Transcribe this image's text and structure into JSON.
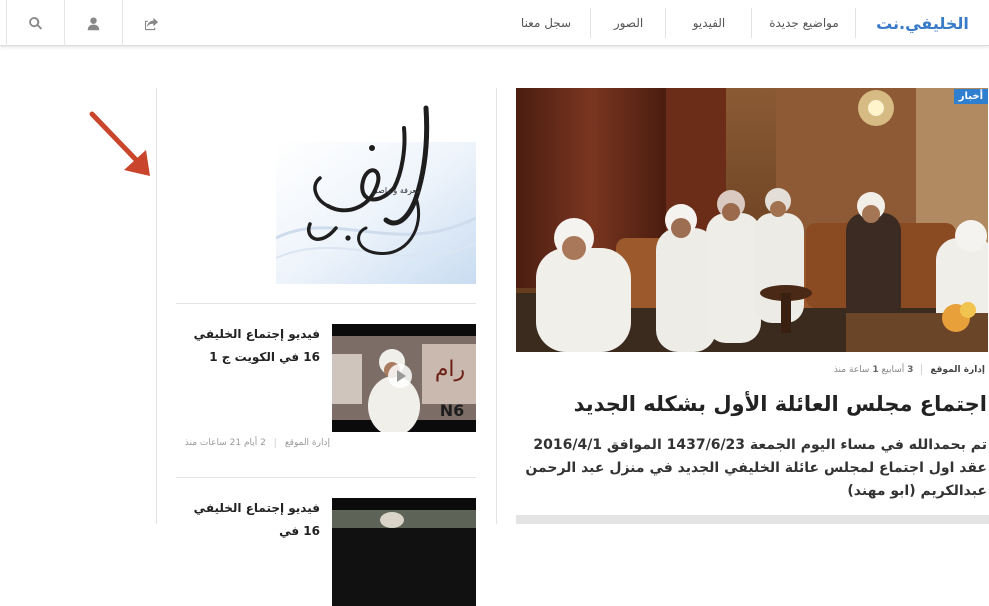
{
  "nav": {
    "brand": "الخليفي.نت",
    "items": [
      {
        "label": "مواضيع جديدة"
      },
      {
        "label": "الفيديو"
      },
      {
        "label": "الصور"
      },
      {
        "label": "سجل معنا"
      }
    ],
    "icons": [
      "share-icon",
      "user-icon",
      "search-icon"
    ]
  },
  "article": {
    "category": "أخبار",
    "author": "إدارة الموقع",
    "time_num": "3",
    "time_unit": "أسابيع",
    "time_count": "1",
    "time_suffix": "ساعة منذ",
    "title": "اجتماع مجلس العائلة الأول بشكله الجديد",
    "excerpt": "تم بحمدالله في مساء اليوم الجمعة 1437/6/23 الموافق 2016/4/1 عقد اول اجتماع لمجلس عائلة الخليفي الجديد في منزل عبد الرحمن عبدالكريم (ابو مهند)"
  },
  "sidebar": {
    "logo_caption": "معرفة وتواصل",
    "posts": [
      {
        "title": "فيديو إجتماع الخليفي 16 في الكويت ج 1",
        "author": "إدارة الموقع",
        "time": "2 أيام 21 ساعات منذ"
      },
      {
        "title": "فيديو إجتماع الخليفي 16 في",
        "author": "",
        "time": ""
      }
    ]
  },
  "colors": {
    "accent": "#2f7fd1",
    "brand": "#3a7bc8",
    "arrow": "#c9452c"
  }
}
